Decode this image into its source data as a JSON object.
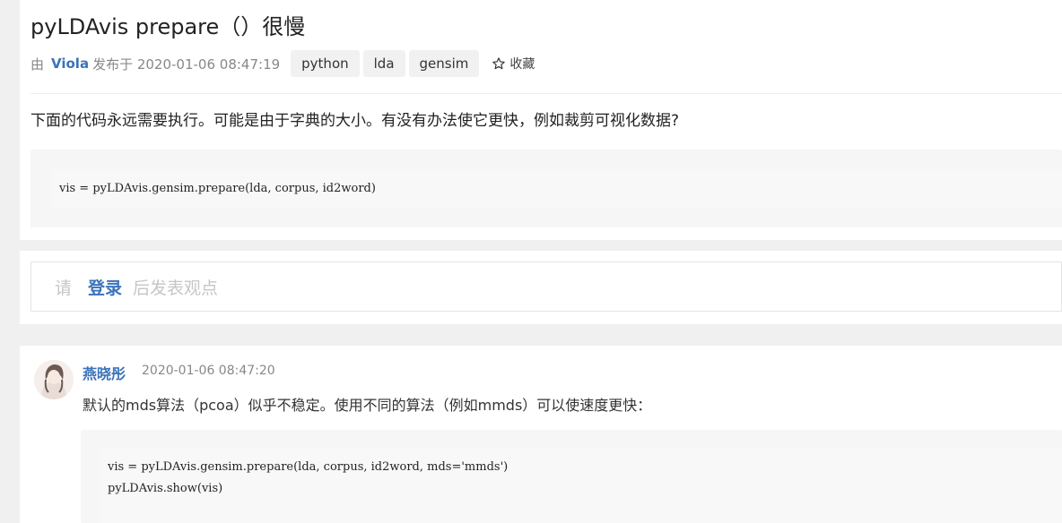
{
  "question": {
    "title": "pyLDAvis prepare（）很慢",
    "by_label": "由",
    "author": "Viola",
    "posted_label": "发布于 2020-01-06 08:47:19",
    "tags": [
      "python",
      "lda",
      "gensim"
    ],
    "collect_label": "收藏",
    "body": "下面的代码永远需要执行。可能是由于字典的大小。有没有办法使它更快，例如裁剪可视化数据?",
    "code": [
      "vis = pyLDAvis.gensim.prepare(lda, corpus, id2word)"
    ]
  },
  "login_prompt": {
    "prefix": "请",
    "link": "登录",
    "suffix": "后发表观点"
  },
  "answer": {
    "author": "燕晓彤",
    "time": "2020-01-06 08:47:20",
    "body": "默认的mds算法（pcoa）似乎不稳定。使用不同的算法（例如mmds）可以使速度更快：",
    "code": [
      "vis = pyLDAvis.gensim.prepare(lda, corpus, id2word, mds='mmds')",
      "pyLDAvis.show(vis)"
    ]
  },
  "colors": {
    "link": "#3b73b9",
    "muted": "#888888",
    "background": "#f0f0f0"
  },
  "icons": {
    "collect": "star-icon",
    "avatar": "avatar"
  }
}
